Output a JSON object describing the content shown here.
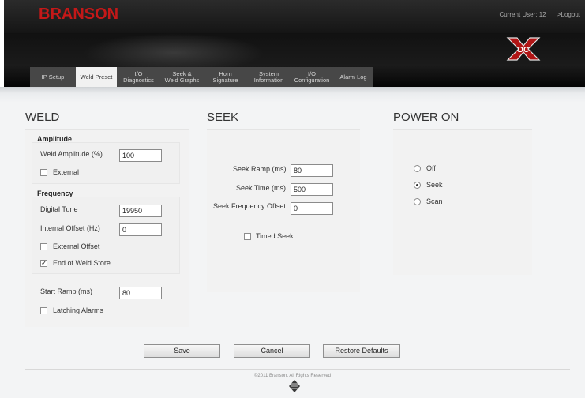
{
  "header": {
    "logo": "BRANSON",
    "current_user": "Current User: 12",
    "logout": ">Logout",
    "emblem_icon": "dc-x-logo-icon"
  },
  "tabs": [
    {
      "label": "IP Setup",
      "active": false
    },
    {
      "label": "Weld Preset",
      "active": true
    },
    {
      "label": "I/O Diagnostics",
      "active": false
    },
    {
      "label": [
        "Seek &",
        "Weld Graphs"
      ],
      "active": false
    },
    {
      "label": [
        "Horn",
        "Signature"
      ],
      "active": false
    },
    {
      "label": [
        "System",
        "Information"
      ],
      "active": false
    },
    {
      "label": [
        "I/O",
        "Configuration"
      ],
      "active": false
    },
    {
      "label": "Alarm Log",
      "active": false
    }
  ],
  "weld": {
    "title": "WELD",
    "amplitude": {
      "heading": "Amplitude",
      "weld_amplitude_label": "Weld Amplitude (%)",
      "weld_amplitude_value": "100",
      "external_label": "External",
      "external_checked": false
    },
    "frequency": {
      "heading": "Frequency",
      "digital_tune_label": "Digital Tune",
      "digital_tune_value": "19950",
      "internal_offset_label": "Internal Offset (Hz)",
      "internal_offset_value": "0",
      "external_offset_label": "External Offset",
      "external_offset_checked": false,
      "end_of_weld_store_label": "End of Weld Store",
      "end_of_weld_store_checked": true
    },
    "start_ramp_label": "Start Ramp (ms)",
    "start_ramp_value": "80",
    "latching_alarms_label": "Latching Alarms",
    "latching_alarms_checked": false
  },
  "seek": {
    "title": "SEEK",
    "seek_ramp_label": "Seek Ramp (ms)",
    "seek_ramp_value": "80",
    "seek_time_label": "Seek Time (ms)",
    "seek_time_value": "500",
    "seek_freq_offset_label": "Seek Frequency Offset",
    "seek_freq_offset_value": "0",
    "timed_seek_label": "Timed Seek",
    "timed_seek_checked": false
  },
  "power_on": {
    "title": "POWER ON",
    "options": [
      "Off",
      "Seek",
      "Scan"
    ],
    "selected": "Seek"
  },
  "buttons": {
    "save": "Save",
    "cancel": "Cancel",
    "restore": "Restore Defaults"
  },
  "footer": {
    "copyright": "©2011 Branson. All Rights Reserved",
    "emblem_icon": "emerson-emblem-icon"
  }
}
